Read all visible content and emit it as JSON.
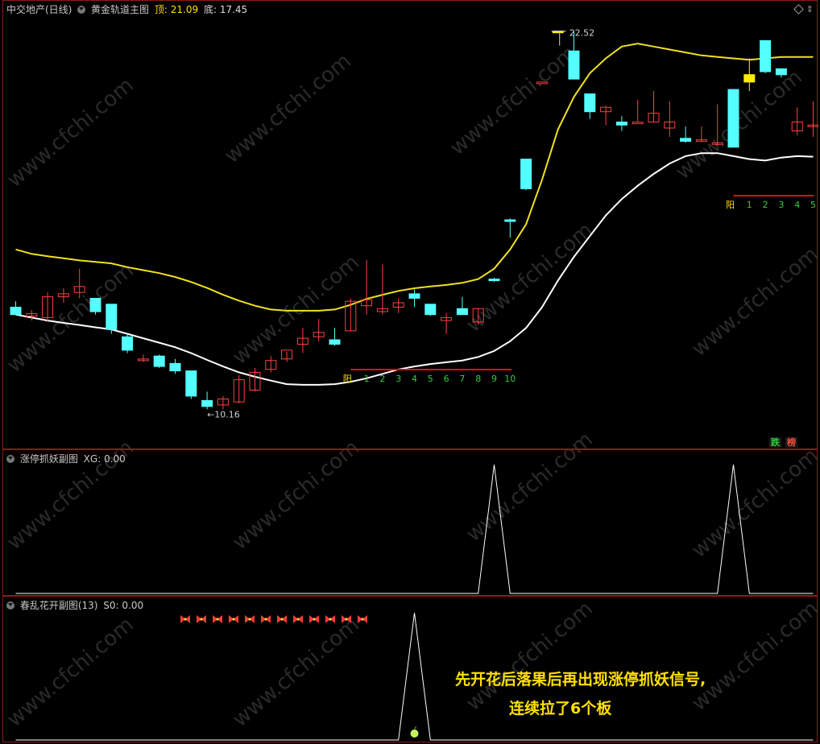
{
  "main_panel": {
    "stock_name": "中交地产(日线)",
    "indicator_name": "黄金轨道主图",
    "top_label": "顶:",
    "top_value": "21.09",
    "bottom_label": "底:",
    "bottom_value": "17.45",
    "high_annotation": "22.52",
    "low_annotation": "10.16",
    "count_label_1": "阳",
    "count_numbers_1": [
      "1",
      "2",
      "3",
      "4",
      "5",
      "6",
      "7",
      "8",
      "9",
      "10"
    ],
    "count_label_2": "阳",
    "count_numbers_2": [
      "1",
      "2",
      "3",
      "4",
      "5"
    ],
    "badge_die": "跌",
    "badge_bang": "榜"
  },
  "sub_panel_1": {
    "title": "涨停抓妖副图",
    "value_label": "XG:",
    "value": "0.00"
  },
  "sub_panel_2": {
    "title": "春乱花开副图(13)",
    "value_label": "S0:",
    "value": "0.00"
  },
  "captions": {
    "line1": "先开花后落果后再出现涨停抓妖信号,",
    "line2": "连续拉了6个板"
  },
  "watermark": "www.cfchi.com",
  "colors": {
    "background": "#000000",
    "border": "#8a1c1c",
    "upper_band": "#f0e020",
    "lower_band": "#ffffff",
    "up_candle": "#ff4040",
    "down_candle": "#54ffff",
    "limit_candle": "#ffee00",
    "count_number": "#2fd03a",
    "signal_line": "#e01010",
    "caption": "#ffe000"
  },
  "chart_data": {
    "type": "candlestick",
    "ohlc": [
      [
        13.2,
        13.4,
        13.0,
        12.95
      ],
      [
        12.9,
        13.1,
        12.75,
        12.98
      ],
      [
        12.85,
        13.7,
        12.7,
        13.55
      ],
      [
        13.55,
        13.85,
        13.35,
        13.65
      ],
      [
        13.7,
        14.5,
        13.5,
        13.9
      ],
      [
        13.5,
        13.5,
        12.95,
        13.05
      ],
      [
        13.3,
        13.3,
        12.3,
        12.45
      ],
      [
        12.2,
        12.3,
        11.65,
        11.75
      ],
      [
        11.45,
        11.6,
        11.35,
        11.45
      ],
      [
        11.55,
        11.6,
        11.15,
        11.2
      ],
      [
        11.3,
        11.45,
        10.95,
        11.05
      ],
      [
        11.05,
        11.05,
        10.1,
        10.2
      ],
      [
        10.05,
        10.35,
        9.75,
        9.85
      ],
      [
        9.9,
        10.2,
        9.75,
        10.1
      ],
      [
        10.0,
        10.9,
        9.95,
        10.75
      ],
      [
        10.4,
        11.15,
        10.35,
        11.0
      ],
      [
        11.1,
        11.55,
        11.0,
        11.4
      ],
      [
        11.45,
        11.7,
        11.35,
        11.75
      ],
      [
        11.95,
        12.5,
        11.65,
        12.15
      ],
      [
        12.2,
        12.8,
        12.05,
        12.35
      ],
      [
        12.1,
        12.5,
        11.9,
        11.95
      ],
      [
        12.4,
        13.5,
        12.4,
        13.4
      ],
      [
        13.25,
        14.8,
        12.95,
        13.45
      ],
      [
        13.05,
        14.65,
        12.95,
        13.15
      ],
      [
        13.2,
        13.5,
        13.0,
        13.35
      ],
      [
        13.65,
        13.8,
        13.2,
        13.5
      ],
      [
        13.3,
        13.3,
        12.9,
        12.95
      ],
      [
        12.75,
        13.0,
        12.3,
        12.85
      ],
      [
        13.15,
        13.55,
        12.95,
        12.95
      ],
      [
        12.7,
        13.15,
        12.6,
        13.15
      ],
      [
        14.15,
        14.2,
        14.05,
        14.1
      ],
      [
        16.15,
        16.2,
        15.55,
        16.1
      ],
      [
        18.2,
        18.2,
        17.15,
        17.2
      ],
      [
        20.8,
        20.8,
        20.8,
        20.8
      ],
      [
        22.52,
        22.52,
        22.52,
        22.52
      ],
      [
        21.85,
        22.52,
        20.9,
        20.9
      ],
      [
        20.4,
        20.4,
        19.55,
        19.8
      ],
      [
        19.8,
        20.0,
        19.35,
        19.95
      ],
      [
        19.45,
        19.65,
        19.15,
        19.35
      ],
      [
        19.4,
        20.2,
        19.45,
        19.45
      ],
      [
        19.45,
        20.5,
        19.45,
        19.75
      ],
      [
        19.25,
        20.15,
        18.95,
        19.45
      ],
      [
        18.9,
        19.3,
        18.75,
        18.8
      ],
      [
        18.85,
        19.3,
        18.8,
        18.85
      ],
      [
        18.75,
        20.05,
        18.65,
        18.75
      ],
      [
        20.55,
        20.55,
        18.6,
        18.6
      ],
      [
        20.8,
        21.6,
        20.5,
        21.05
      ],
      [
        22.2,
        22.2,
        21.1,
        21.15
      ],
      [
        21.25,
        21.25,
        20.95,
        21.05
      ],
      [
        19.15,
        19.95,
        19.0,
        19.45
      ],
      [
        19.35,
        20.15,
        18.95,
        19.35
      ]
    ],
    "upper_band": [
      15.15,
      15.0,
      14.92,
      14.85,
      14.78,
      14.73,
      14.68,
      14.55,
      14.45,
      14.35,
      14.22,
      14.05,
      13.85,
      13.62,
      13.42,
      13.25,
      13.12,
      13.08,
      13.08,
      13.08,
      13.12,
      13.28,
      13.48,
      13.62,
      13.75,
      13.84,
      13.9,
      13.95,
      14.02,
      14.15,
      14.5,
      15.15,
      16.0,
      17.5,
      19.2,
      20.3,
      21.1,
      21.6,
      22.0,
      22.1,
      22.0,
      21.9,
      21.8,
      21.7,
      21.65,
      21.6,
      21.55,
      21.6,
      21.65,
      21.65,
      21.65
    ],
    "lower_band": [
      12.95,
      12.85,
      12.75,
      12.67,
      12.6,
      12.52,
      12.45,
      12.3,
      12.15,
      12.0,
      11.85,
      11.65,
      11.42,
      11.2,
      11.0,
      10.85,
      10.72,
      10.6,
      10.58,
      10.58,
      10.6,
      10.68,
      10.8,
      10.95,
      11.1,
      11.2,
      11.28,
      11.34,
      11.4,
      11.52,
      11.72,
      12.05,
      12.5,
      13.2,
      14.1,
      14.9,
      15.6,
      16.3,
      16.85,
      17.3,
      17.7,
      18.05,
      18.3,
      18.4,
      18.4,
      18.3,
      18.2,
      18.15,
      18.25,
      18.3,
      18.28
    ],
    "sub1_signal": [
      0,
      0,
      0,
      0,
      0,
      0,
      0,
      0,
      0,
      0,
      0,
      0,
      0,
      0,
      0,
      0,
      0,
      0,
      0,
      0,
      0,
      0,
      0,
      0,
      0,
      0,
      0,
      0,
      0,
      0,
      1,
      0,
      0,
      0,
      0,
      0,
      0,
      0,
      0,
      0,
      0,
      0,
      0,
      0,
      0,
      1,
      0,
      0,
      0,
      0,
      0
    ],
    "sub2_signal": [
      0,
      0,
      0,
      0,
      0,
      0,
      0,
      0,
      0,
      0,
      0,
      0,
      0,
      0,
      0,
      0,
      0,
      0,
      0,
      0,
      0,
      0,
      0,
      0,
      0,
      1,
      0,
      0,
      0,
      0,
      0,
      0,
      0,
      0,
      0,
      0,
      0,
      0,
      0,
      0,
      0,
      0,
      0,
      0,
      0,
      0,
      0,
      0,
      0,
      0,
      0
    ],
    "flower_markers_count": 12,
    "high_label_value": 22.52,
    "low_label_value": 10.16
  }
}
